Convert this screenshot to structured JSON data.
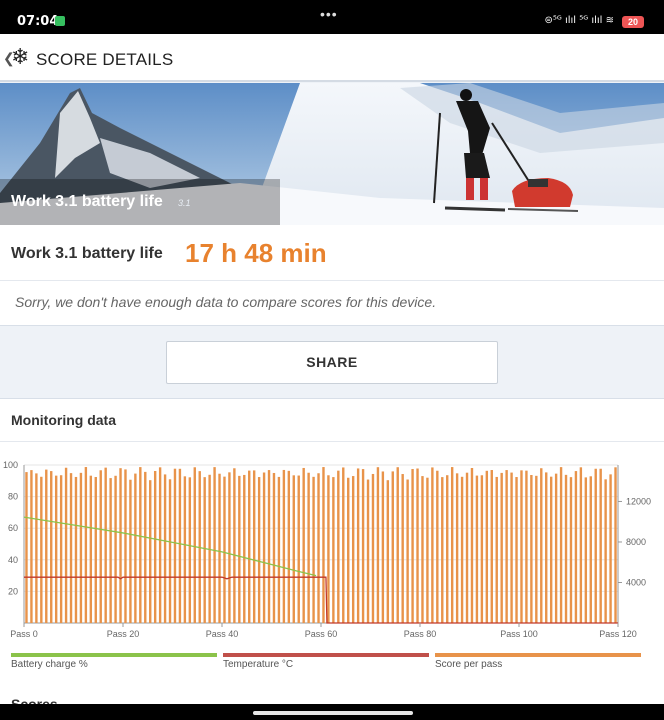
{
  "status_bar": {
    "time": "07:04",
    "network_text": "⊜⁵ᴳ ılıl ⁵ᴳ ılıl ≋",
    "battery": "20",
    "dots": "•••"
  },
  "header": {
    "title": "SCORE DETAILS",
    "back_icon": "chevron-left-icon",
    "app_icon": "snowflake-icon"
  },
  "hero": {
    "title": "Work 3.1 battery life",
    "version": "3.1"
  },
  "result": {
    "label": "Work 3.1 battery life",
    "value": "17 h 48 min",
    "value_color": "#e8822e",
    "note": "Sorry, we don't have enough data to compare scores for this device."
  },
  "share": {
    "label": "SHARE"
  },
  "monitoring": {
    "title": "Monitoring data",
    "next_section_title": "Scores"
  },
  "chart_data": {
    "type": "bar",
    "title": "",
    "left_axis_ticks": [
      "100",
      "80",
      "60",
      "40",
      "20"
    ],
    "right_axis_ticks": [
      "12000",
      "8000",
      "4000"
    ],
    "x_ticks": [
      "Pass 0",
      "Pass 20",
      "Pass 40",
      "Pass 60",
      "Pass 80",
      "Pass 100",
      "Pass 120"
    ],
    "ylim_left": [
      0,
      100
    ],
    "ylim_right": [
      0,
      15600
    ],
    "xlim": [
      0,
      120
    ],
    "series": [
      {
        "name": "Battery charge %",
        "color": "#8bc34a",
        "type": "line",
        "points": [
          [
            0,
            67
          ],
          [
            10,
            62
          ],
          [
            20,
            57
          ],
          [
            30,
            51
          ],
          [
            40,
            45
          ],
          [
            50,
            37
          ],
          [
            55,
            33
          ],
          [
            59,
            30
          ]
        ]
      },
      {
        "name": "Temperature °C",
        "color": "#c0392b",
        "type": "line",
        "points": [
          [
            0,
            29
          ],
          [
            19,
            29
          ],
          [
            19.5,
            28
          ],
          [
            20,
            29
          ],
          [
            40,
            29
          ],
          [
            41,
            28
          ],
          [
            42,
            29
          ],
          [
            61,
            29
          ],
          [
            61.2,
            0
          ],
          [
            120,
            0
          ]
        ]
      },
      {
        "name": "Score per pass",
        "color": "#e8934a",
        "type": "bar",
        "count": 120,
        "typical_value": 14900,
        "variation": 500
      }
    ],
    "grid": true
  }
}
